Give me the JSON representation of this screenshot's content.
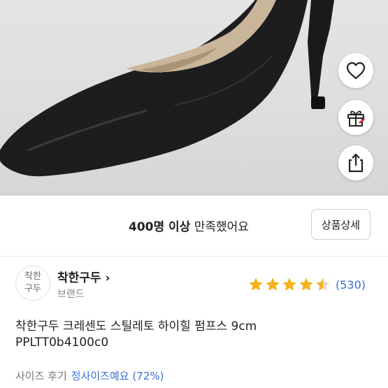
{
  "satisfaction": {
    "count": "400명 이상",
    "suffix": "만족했어요"
  },
  "buttons": {
    "detail_label": "상품상세"
  },
  "fab_icons": [
    "heart-icon",
    "gift-icon",
    "share-icon"
  ],
  "brand": {
    "logo_line1": "착한",
    "logo_line2": "구두",
    "name": "착한구두",
    "chevron": "›",
    "label": "브랜드"
  },
  "rating": {
    "value": 4.5,
    "max": 5,
    "reviews": "(530)",
    "star_color": "#f6b21b"
  },
  "product": {
    "name": "착한구두 크레센도 스틸레토 하이힐 펌프스 9cm",
    "code": "PPLTT0b4100c0"
  },
  "size_review": {
    "label": "사이즈 후기",
    "value": "정사이즈예요",
    "percent": "(72%)"
  },
  "colors": {
    "link_blue": "#3b6fd6",
    "star": "#f6b21b"
  }
}
